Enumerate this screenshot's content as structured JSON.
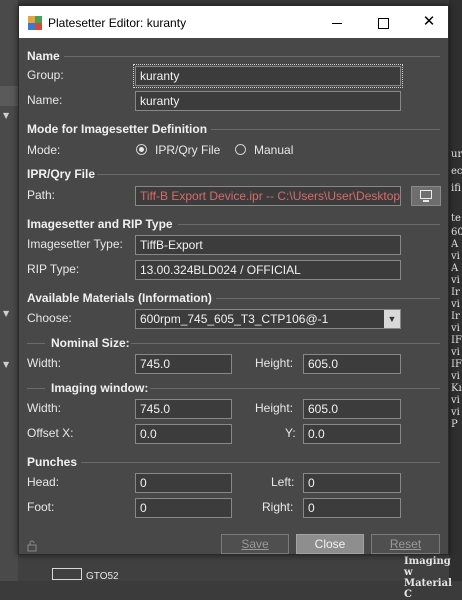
{
  "window": {
    "title": "Platesetter Editor: kuranty",
    "minimize_glyph": "",
    "close_glyph": "✕"
  },
  "sections": {
    "name": "Name",
    "mode": "Mode for Imagesetter Definition",
    "ipr": "IPR/Qry File",
    "imagesetter": "Imagesetter and RIP Type",
    "materials": "Available Materials (Information)",
    "nominal": "Nominal Size:",
    "imaging": "Imaging window:",
    "punches": "Punches"
  },
  "name": {
    "group_label": "Group:",
    "group_value": "kuranty",
    "name_label": "Name:",
    "name_value": "kuranty"
  },
  "mode": {
    "label": "Mode:",
    "options": [
      "IPR/Qry File",
      "Manual"
    ],
    "selected": "IPR/Qry File"
  },
  "ipr": {
    "path_label": "Path:",
    "path_value": "Tiff-B Export Device.ipr -- C:\\Users\\User\\Desktop"
  },
  "imagesetter": {
    "type_label": "Imagesetter Type:",
    "type_value": "TiffB-Export",
    "rip_label": "RIP Type:",
    "rip_value": "13.00.324BLD024 / OFFICIAL"
  },
  "materials": {
    "choose_label": "Choose:",
    "choose_value": "600rpm_745_605_T3_CTP106@-1"
  },
  "nominal": {
    "width_label": "Width:",
    "width_value": "745.0",
    "height_label": "Height:",
    "height_value": "605.0"
  },
  "imaging": {
    "width_label": "Width:",
    "width_value": "745.0",
    "height_label": "Height:",
    "height_value": "605.0",
    "offset_x_label": "Offset X:",
    "offset_x_value": "0.0",
    "y_label": "Y:",
    "y_value": "0.0"
  },
  "punches": {
    "head_label": "Head:",
    "head_value": "0",
    "left_label": "Left:",
    "left_value": "0",
    "foot_label": "Foot:",
    "foot_value": "0",
    "right_label": "Right:",
    "right_value": "0"
  },
  "buttons": {
    "save": "Save",
    "close": "Close",
    "reset": "Reset"
  },
  "background": {
    "tree_item": "GTO52",
    "right_fragments": [
      "ur",
      "ec",
      "ifi",
      "te",
      "60",
      "A",
      "vi",
      "A",
      "vi",
      "Ir",
      "vi",
      "Ir",
      "vi",
      "IF",
      "vi",
      "IF",
      "vi",
      "Kı",
      "vi",
      "vi",
      "P"
    ],
    "bottom_text_1": "Imaging w",
    "bottom_text_2": "Material C"
  },
  "colors": {
    "window_bg": "#484848",
    "field_border": "#888888",
    "path_text": "#d96a6a",
    "primary_button": "#8e8e8e"
  }
}
